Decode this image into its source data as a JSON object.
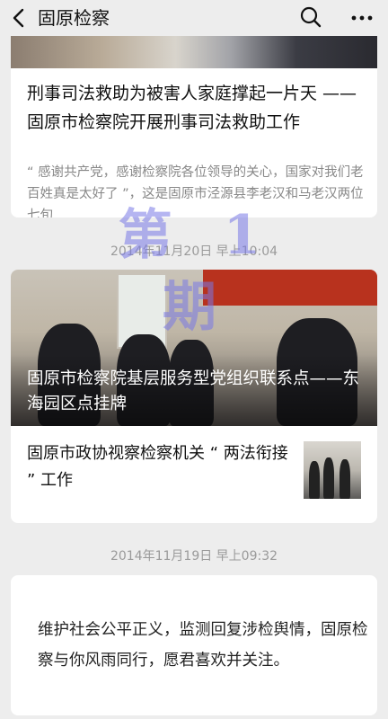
{
  "header": {
    "title": "固原检察",
    "back_icon": "chevron-left-icon",
    "search_icon": "search-icon",
    "more_icon": "more-dots-icon"
  },
  "watermark": "第 1 期",
  "article1": {
    "headline": "刑事司法救助为被害人家庭撑起一片天 —— 固原市检察院开展刑事司法救助工作",
    "summary": "“ 感谢共产党，感谢检察院各位领导的关心，国家对我们老百姓真是太好了 ”，这是固原市泾源县李老汉和马老汉两位七旬"
  },
  "date1": "2014年11月20日 早上10:04",
  "article2": {
    "photo_caption": "固原市检察院基层服务型党组织联系点——东海园区点挂牌",
    "sub_headline": "固原市政协视察检察机关 “ 两法衔接 ” 工作"
  },
  "date2": "2014年11月19日 早上09:32",
  "message": {
    "text": "维护社会公平正义，监测回复涉检舆情，固原检察与你风雨同行，愿君喜欢并关注。"
  }
}
